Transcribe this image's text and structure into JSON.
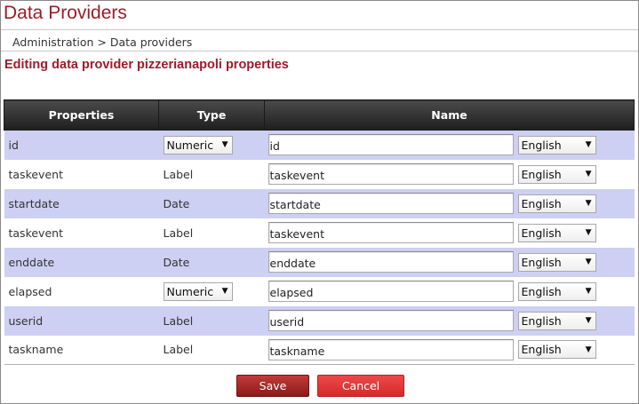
{
  "header": {
    "title": "Data Providers"
  },
  "breadcrumb": {
    "text": "Administration > Data providers"
  },
  "section": {
    "heading": "Editing data provider pizzerianapoli properties"
  },
  "table": {
    "columns": [
      "Properties",
      "Type",
      "Name"
    ],
    "rows": [
      {
        "property": "id",
        "type": "Numeric",
        "type_is_select": true,
        "name": "id",
        "language": "English"
      },
      {
        "property": "taskevent",
        "type": "Label",
        "type_is_select": false,
        "name": "taskevent",
        "language": "English"
      },
      {
        "property": "startdate",
        "type": "Date",
        "type_is_select": false,
        "name": "startdate",
        "language": "English"
      },
      {
        "property": "taskevent",
        "type": "Label",
        "type_is_select": false,
        "name": "taskevent",
        "language": "English"
      },
      {
        "property": "enddate",
        "type": "Date",
        "type_is_select": false,
        "name": "enddate",
        "language": "English"
      },
      {
        "property": "elapsed",
        "type": "Numeric",
        "type_is_select": true,
        "name": "elapsed",
        "language": "English"
      },
      {
        "property": "userid",
        "type": "Label",
        "type_is_select": false,
        "name": "userid",
        "language": "English"
      },
      {
        "property": "taskname",
        "type": "Label",
        "type_is_select": false,
        "name": "taskname",
        "language": "English"
      }
    ]
  },
  "actions": {
    "save_label": "Save",
    "cancel_label": "Cancel"
  },
  "icons": {
    "dropdown": "chevron-down-icon"
  },
  "colors": {
    "title": "#9c1c28",
    "alt_row": "#cdd0f3",
    "header_bg": "#2b2b2b",
    "save_button": "#a82a2a",
    "cancel_button": "#e03a3a"
  }
}
